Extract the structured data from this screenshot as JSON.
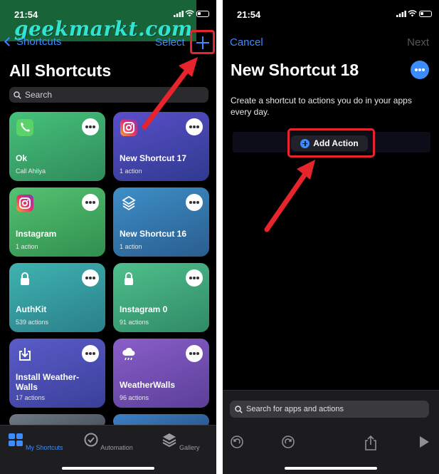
{
  "watermark": "geekmarkt.com",
  "left": {
    "time": "21:54",
    "back_label": "Shortcuts",
    "select_label": "Select",
    "title": "All Shortcuts",
    "search_placeholder": "Search",
    "cards": [
      {
        "name": "Ok",
        "sub": "Call Ahilya",
        "icon": "phone-icon"
      },
      {
        "name": "New Shortcut 17",
        "sub": "1 action",
        "icon": "instagram-icon"
      },
      {
        "name": "Instagram",
        "sub": "1 action",
        "icon": "instagram-icon"
      },
      {
        "name": "New Shortcut 16",
        "sub": "1 action",
        "icon": "layers-icon"
      },
      {
        "name": "AuthKit",
        "sub": "539 actions",
        "icon": "lock-icon"
      },
      {
        "name": "Instagram 0",
        "sub": "91 actions",
        "icon": "lock-icon"
      },
      {
        "name": "Install Weather-Walls",
        "sub": "17 actions",
        "icon": "download-icon"
      },
      {
        "name": "WeatherWalls",
        "sub": "96 actions",
        "icon": "cloud-rain-icon"
      }
    ],
    "tabs": [
      {
        "label": "My Shortcuts",
        "color": "#3c8cff"
      },
      {
        "label": "Automation",
        "color": "#9a9aa0"
      },
      {
        "label": "Gallery",
        "color": "#9a9aa0"
      }
    ]
  },
  "right": {
    "time": "21:54",
    "cancel_label": "Cancel",
    "next_label": "Next",
    "title": "New Shortcut 18",
    "description": "Create a shortcut to actions you do in your apps every day.",
    "add_action_label": "Add Action",
    "search_placeholder": "Search for apps and actions"
  },
  "colors": {
    "accent": "#3c8cff",
    "highlight_red": "#e7242b"
  }
}
